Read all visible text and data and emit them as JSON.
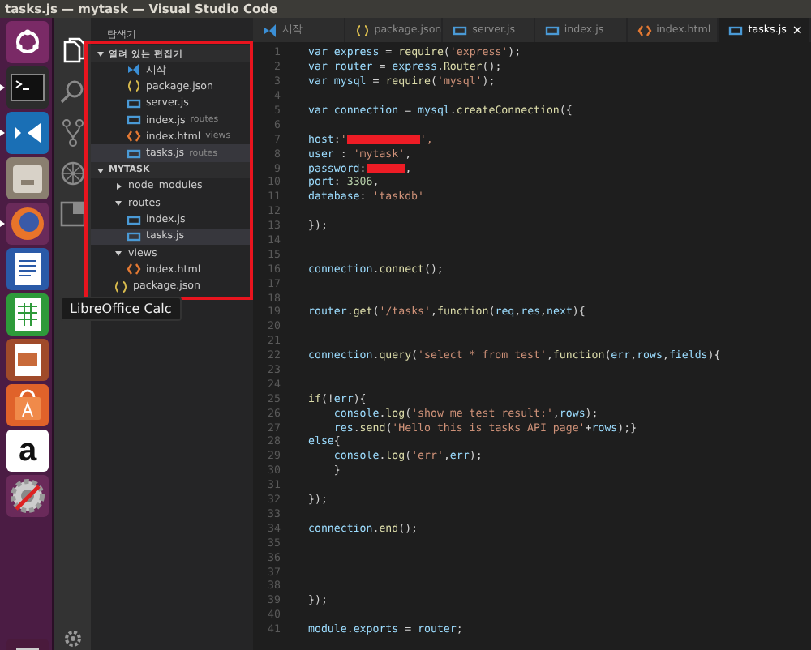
{
  "window": {
    "title": "tasks.js — mytask — Visual Studio Code"
  },
  "launcher": {
    "items": [
      {
        "kind": "dash",
        "running": false
      },
      {
        "kind": "terminal",
        "running": true
      },
      {
        "kind": "vscode",
        "running": true
      },
      {
        "kind": "files",
        "running": false
      },
      {
        "kind": "firefox",
        "running": true
      },
      {
        "kind": "writer",
        "running": false
      },
      {
        "kind": "calc",
        "running": false
      },
      {
        "kind": "impress",
        "running": false
      },
      {
        "kind": "software",
        "running": false
      },
      {
        "kind": "amazon",
        "running": false,
        "glyph": "a"
      },
      {
        "kind": "settings",
        "running": false
      },
      {
        "kind": "trash",
        "running": false
      }
    ],
    "tooltip": "LibreOffice Calc"
  },
  "activity_bar": {
    "items": [
      {
        "kind": "files",
        "selected": true
      },
      {
        "kind": "search",
        "selected": false
      },
      {
        "kind": "git",
        "selected": false
      },
      {
        "kind": "debug",
        "selected": false
      },
      {
        "kind": "extensions",
        "selected": false
      }
    ]
  },
  "sidebar": {
    "title": "탐색기",
    "open_editors": {
      "label": "열려 있는 편집기",
      "expanded": true,
      "items": [
        {
          "kind": "vscode",
          "name": "시작",
          "selected": false
        },
        {
          "kind": "json",
          "name": "package.json",
          "selected": false
        },
        {
          "kind": "js",
          "name": "server.js",
          "selected": false
        },
        {
          "kind": "js",
          "name": "index.js",
          "hint": "routes",
          "selected": false
        },
        {
          "kind": "html",
          "name": "index.html",
          "hint": "views",
          "selected": false
        },
        {
          "kind": "js",
          "name": "tasks.js",
          "hint": "routes",
          "selected": true
        }
      ]
    },
    "project": {
      "label": "MYTASK",
      "expanded": true,
      "items": [
        {
          "kind": "folder",
          "name": "node_modules",
          "expanded": false,
          "selected": false
        },
        {
          "kind": "folder",
          "name": "routes",
          "expanded": true,
          "selected": false,
          "children": [
            {
              "kind": "js",
              "name": "index.js",
              "selected": false
            },
            {
              "kind": "js",
              "name": "tasks.js",
              "selected": true
            }
          ]
        },
        {
          "kind": "folder",
          "name": "views",
          "expanded": true,
          "selected": false,
          "children": [
            {
              "kind": "html",
              "name": "index.html",
              "selected": false
            }
          ]
        },
        {
          "kind": "json",
          "name": "package.json",
          "selected": false
        }
      ]
    }
  },
  "tabs": [
    {
      "kind": "vscode",
      "label": "시작",
      "selected": false
    },
    {
      "kind": "json",
      "label": "package.json",
      "selected": false
    },
    {
      "kind": "js",
      "label": "server.js",
      "selected": false
    },
    {
      "kind": "js",
      "label": "index.js",
      "selected": false
    },
    {
      "kind": "html",
      "label": "index.html",
      "selected": false
    },
    {
      "kind": "js",
      "label": "tasks.js",
      "selected": true,
      "close": "×"
    }
  ],
  "editor": {
    "lines": [
      {
        "number": "1",
        "text": "var express = require('express');"
      },
      {
        "number": "2",
        "text": "var router = express.Router();"
      },
      {
        "number": "3",
        "text": "var mysql = require('mysql');"
      },
      {
        "number": "4"
      },
      {
        "number": "5",
        "text": "var connection = mysql.createConnection({"
      },
      {
        "number": "6"
      },
      {
        "number": "7",
        "parts": [
          {
            "kind": "code",
            "text": "host:'"
          },
          {
            "kind": "redaction"
          },
          {
            "kind": "code",
            "text": "',"
          }
        ]
      },
      {
        "number": "8",
        "text": "user : 'mytask',"
      },
      {
        "number": "9",
        "parts": [
          {
            "kind": "code",
            "text": "password:"
          },
          {
            "kind": "redaction"
          },
          {
            "kind": "code",
            "text": ","
          }
        ]
      },
      {
        "number": "10",
        "text": "port: 3306,"
      },
      {
        "number": "11",
        "text": "database: 'taskdb'"
      },
      {
        "number": "12"
      },
      {
        "number": "13",
        "text": "});"
      },
      {
        "number": "14"
      },
      {
        "number": "15"
      },
      {
        "number": "16",
        "text": "connection.connect();"
      },
      {
        "number": "17"
      },
      {
        "number": "18"
      },
      {
        "number": "19",
        "text": "router.get('/tasks',function(req,res,next){"
      },
      {
        "number": "20"
      },
      {
        "number": "21"
      },
      {
        "number": "22",
        "text": "connection.query('select * from test',function(err,rows,fields){"
      },
      {
        "number": "23"
      },
      {
        "number": "24"
      },
      {
        "number": "25",
        "text": "if(!err){"
      },
      {
        "number": "26",
        "text": "    console.log('show me test result:',rows);"
      },
      {
        "number": "27",
        "text": "    res.send('Hello this is tasks API page'+rows);}"
      },
      {
        "number": "28",
        "text": "else{"
      },
      {
        "number": "29",
        "text": "    console.log('err',err);"
      },
      {
        "number": "30",
        "text": "    }"
      },
      {
        "number": "31"
      },
      {
        "number": "32",
        "text": "});"
      },
      {
        "number": "33"
      },
      {
        "number": "34",
        "text": "connection.end();"
      },
      {
        "number": "35"
      },
      {
        "number": "36"
      },
      {
        "number": "37"
      },
      {
        "number": "38"
      },
      {
        "number": "39",
        "text": "});"
      },
      {
        "number": "40"
      },
      {
        "number": "41",
        "text": "module.exports = router;"
      }
    ]
  }
}
